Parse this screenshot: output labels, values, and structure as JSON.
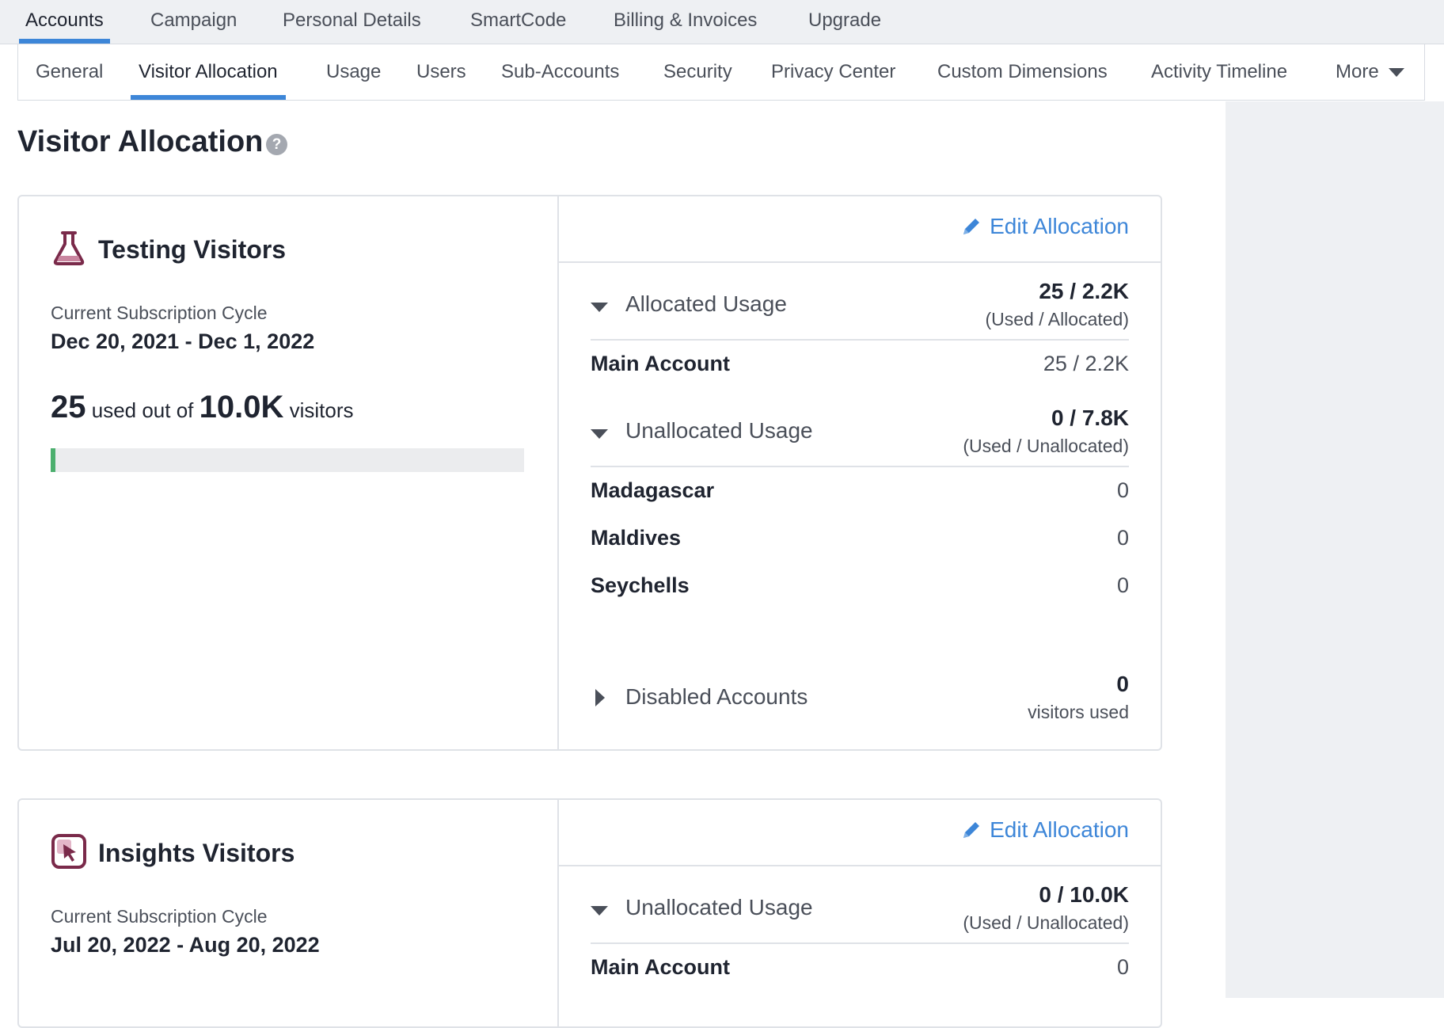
{
  "top_tabs": [
    "Accounts",
    "Campaign",
    "Personal Details",
    "SmartCode",
    "Billing & Invoices",
    "Upgrade"
  ],
  "sub_tabs": [
    "General",
    "Visitor Allocation",
    "Usage",
    "Users",
    "Sub-Accounts",
    "Security",
    "Privacy Center",
    "Custom Dimensions",
    "Activity Timeline",
    "More"
  ],
  "page": {
    "title": "Visitor Allocation",
    "help": "?"
  },
  "testing": {
    "title": "Testing Visitors",
    "cycle_label": "Current Subscription Cycle",
    "cycle_dates": "Dec 20, 2021 - Dec 1, 2022",
    "used": "25",
    "used_text": "used out of",
    "total": "10.0K",
    "visitors_text": "visitors",
    "progress_fraction": 0.0025,
    "edit_label": "Edit Allocation",
    "allocated": {
      "label": "Allocated Usage",
      "value": "25 / 2.2K",
      "sub": "(Used / Allocated)"
    },
    "main_account": {
      "name": "Main Account",
      "value": "25 / 2.2K"
    },
    "unallocated": {
      "label": "Unallocated Usage",
      "value": "0 / 7.8K",
      "sub": "(Used / Unallocated)"
    },
    "countries": [
      {
        "name": "Madagascar",
        "value": "0"
      },
      {
        "name": "Maldives",
        "value": "0"
      },
      {
        "name": "Seychells",
        "value": "0"
      }
    ],
    "disabled": {
      "label": "Disabled Accounts",
      "value": "0",
      "sub": "visitors used"
    }
  },
  "insights": {
    "title": "Insights Visitors",
    "cycle_label": "Current Subscription Cycle",
    "cycle_dates": "Jul 20, 2022 - Aug 20, 2022",
    "edit_label": "Edit Allocation",
    "unallocated": {
      "label": "Unallocated Usage",
      "value": "0 / 10.0K",
      "sub": "(Used / Unallocated)"
    },
    "main_account": {
      "name": "Main Account",
      "value": "0"
    }
  },
  "colors": {
    "accent": "#3d86d8",
    "progress": "#4caf6e",
    "icon": "#7a2a4a"
  }
}
